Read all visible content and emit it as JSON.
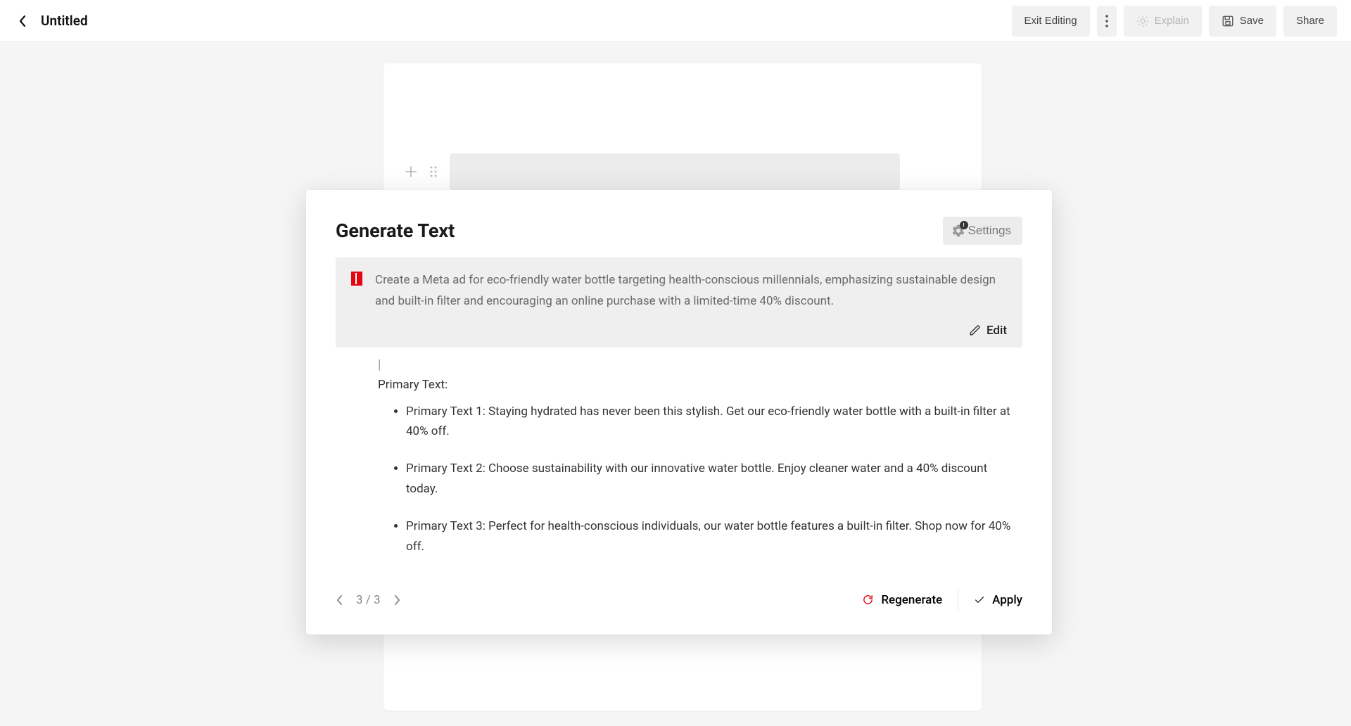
{
  "header": {
    "title": "Untitled",
    "exit_label": "Exit Editing",
    "explain_label": "Explain",
    "save_label": "Save",
    "share_label": "Share"
  },
  "modal": {
    "title": "Generate Text",
    "settings_label": "Settings",
    "prompt": "Create a Meta ad for eco-friendly water bottle targeting health-conscious millennials, emphasizing sustainable design and built-in filter and encouraging an online purchase with a limited-time 40% discount.",
    "edit_label": "Edit",
    "output": {
      "heading": "Primary Text:",
      "items": [
        "Primary Text 1: Staying hydrated has never been this stylish. Get our eco-friendly water bottle with a built-in filter at 40% off.",
        "Primary Text 2: Choose sustainability with our innovative water bottle. Enjoy cleaner water and a 40% discount today.",
        "Primary Text 3: Perfect for health-conscious individuals, our water bottle features a built-in filter. Shop now for 40% off."
      ]
    },
    "pager": {
      "current": 3,
      "total": 3,
      "display": "3 / 3"
    },
    "regenerate_label": "Regenerate",
    "apply_label": "Apply"
  }
}
